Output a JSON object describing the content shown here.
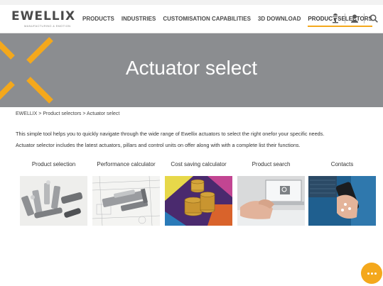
{
  "header": {
    "logo_text": "EWELLIX",
    "logo_tagline": "MANUFACTURING & EMOTION",
    "nav": [
      {
        "label": "PRODUCTS"
      },
      {
        "label": "INDUSTRIES"
      },
      {
        "label": "CUSTOMISATION CAPABILITIES"
      },
      {
        "label": "3D DOWNLOAD"
      },
      {
        "label": "PRODUCT SELECTORS",
        "active": true
      }
    ],
    "tools": [
      "microphone-icon",
      "user-icon",
      "search-icon"
    ]
  },
  "hero": {
    "title": "Actuator select",
    "background": "#8b8d90",
    "accent": "#f4a81c"
  },
  "breadcrumb": {
    "items": [
      "EWELLIX",
      "Product selectors",
      "Actuator select"
    ],
    "separator": " > "
  },
  "intro": {
    "line1": "This simple tool helps you to quickly navigate through the wide range of Ewellix actuators to select the right onefor your specific needs.",
    "line2": "Actuator selector includes the latest actuators, pillars and control units on offer along with with a complete list their functions."
  },
  "cards": [
    {
      "label": "Product selection",
      "image": "actuators-photo"
    },
    {
      "label": "Performance calculator",
      "image": "technical-drawing-photo"
    },
    {
      "label": "Cost saving calculator",
      "image": "coins-photo"
    },
    {
      "label": "Product search",
      "image": "laptop-search-photo"
    },
    {
      "label": "Contacts",
      "image": "phone-contact-photo"
    }
  ],
  "chat": {
    "icon": "chat-icon"
  }
}
